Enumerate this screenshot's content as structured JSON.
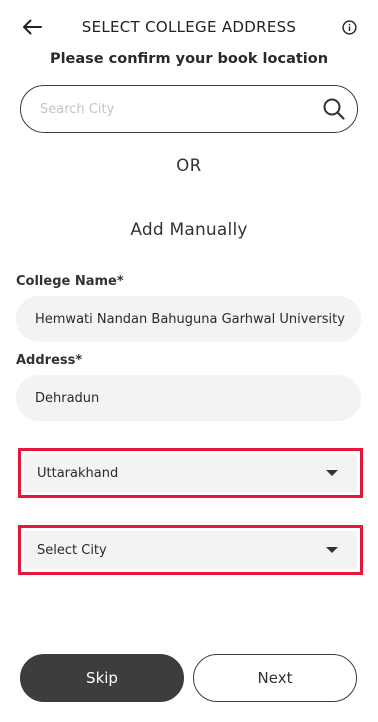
{
  "header": {
    "title": "SELECT COLLEGE ADDRESS",
    "back_icon": "back-arrow-icon",
    "info_icon": "info-icon"
  },
  "subtitle": "Please confirm your book location",
  "search": {
    "placeholder": "Search City",
    "icon": "search-icon"
  },
  "or_text": "OR",
  "manual": {
    "title": "Add Manually",
    "college_label": "College Name*",
    "college_value": "Hemwati Nandan Bahuguna Garhwal University",
    "address_label": "Address*",
    "address_value": "Dehradun",
    "state_value": "Uttarakhand",
    "city_value": "Select City"
  },
  "buttons": {
    "skip": "Skip",
    "next": "Next"
  },
  "colors": {
    "highlight": "#e5173f",
    "primary_dark": "#3d3d3d",
    "field_bg": "#f3f3f3"
  }
}
